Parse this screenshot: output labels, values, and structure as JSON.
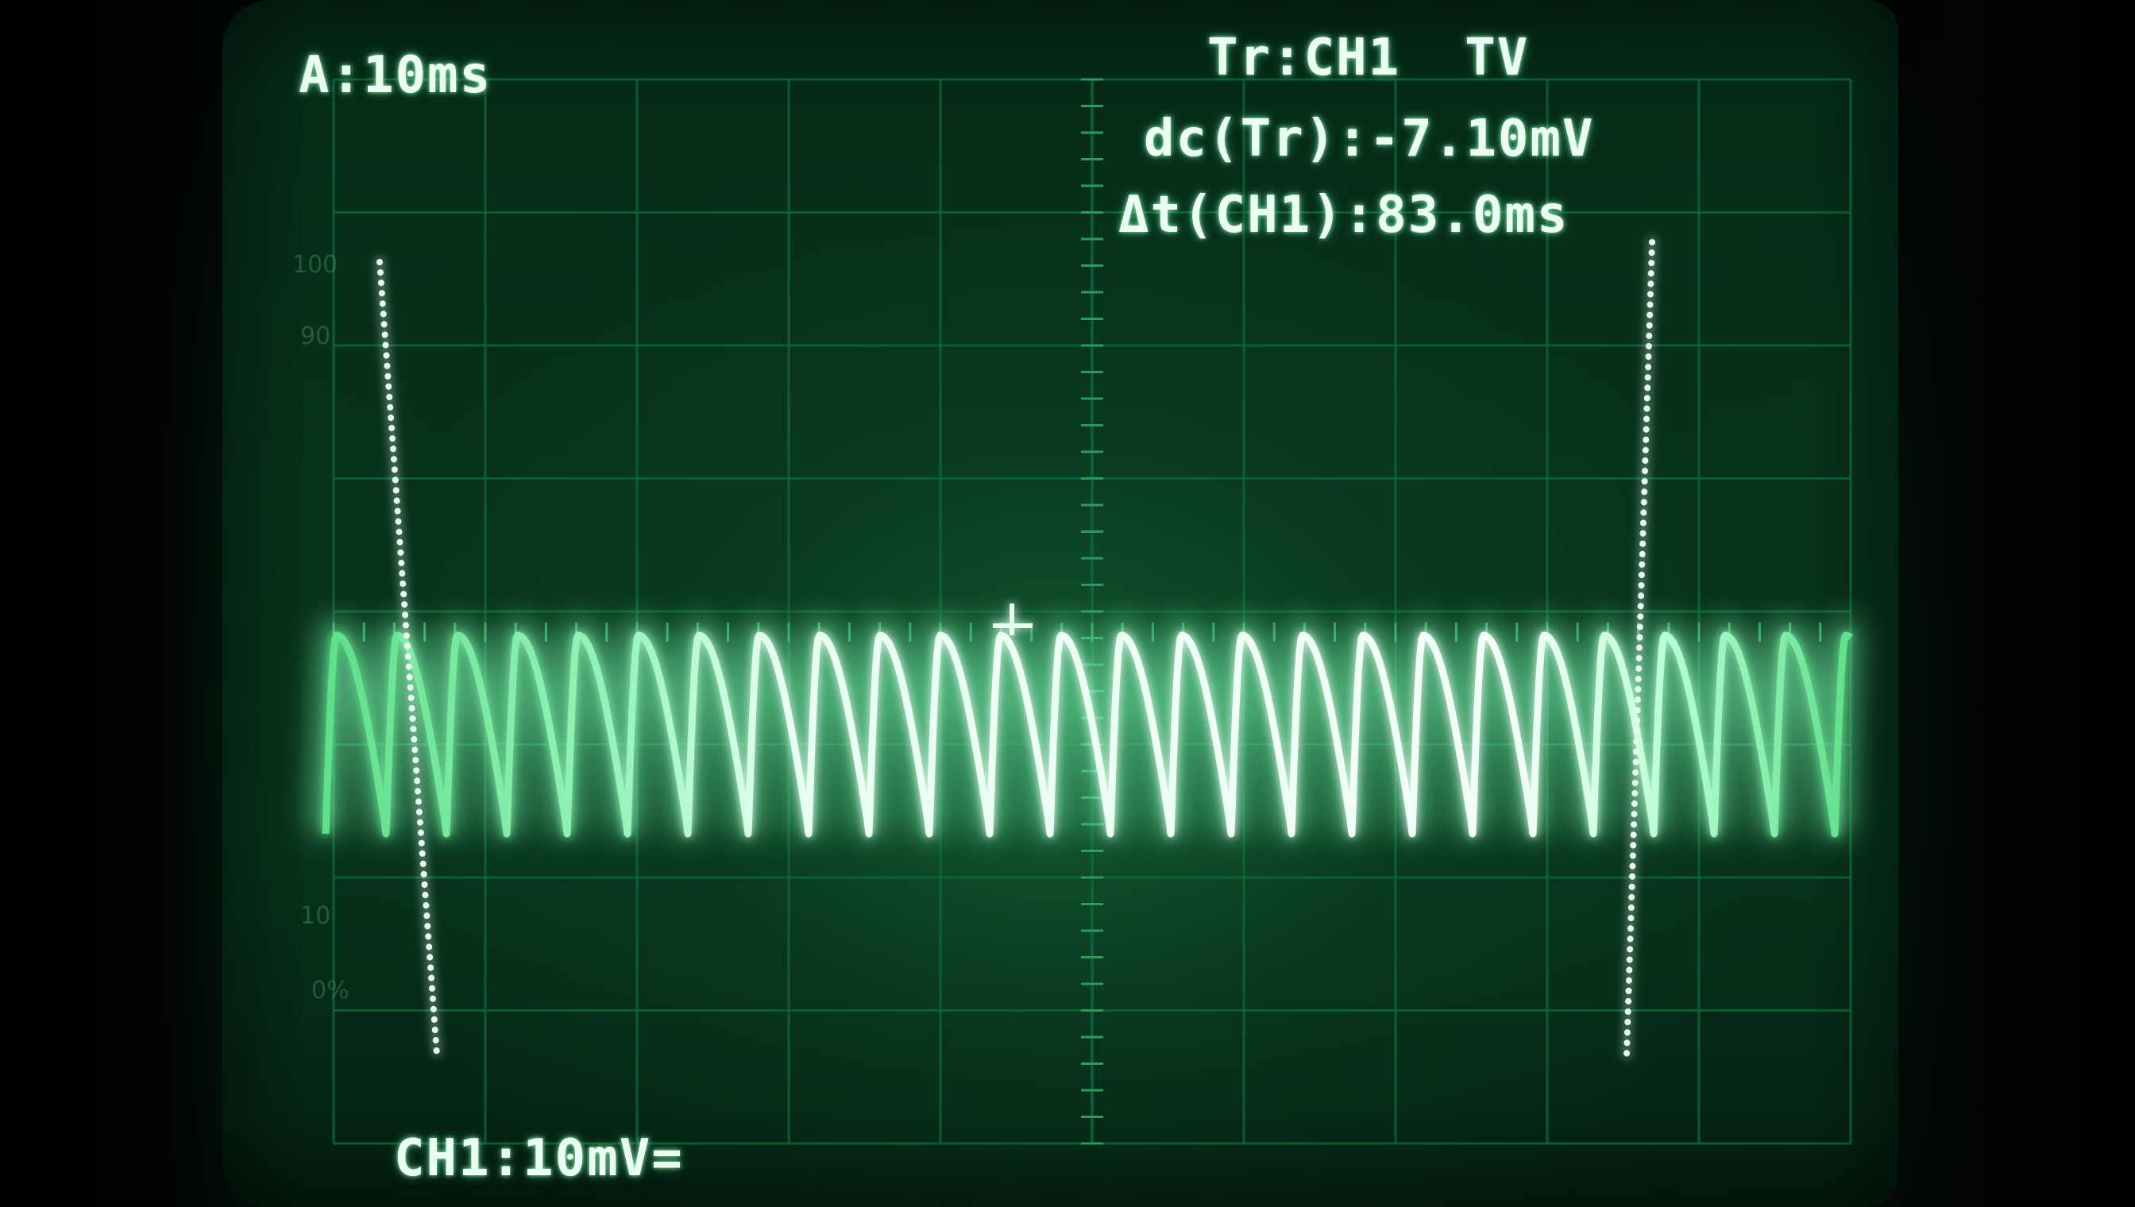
{
  "readout": {
    "timebase": "A:10ms",
    "trigger": "Tr:CH1  TV",
    "dc_level": "dc(Tr):-7.10mV",
    "delta_t": "Δt(CH1):83.0ms",
    "channel_scale": "CH1:10mV="
  },
  "graticule_labels": {
    "top": "100",
    "ninety": "90",
    "ten": "10",
    "zero": "0%"
  },
  "colors": {
    "trace": "#c8ffe0",
    "trace_dim": "#5fe08a",
    "grid": "#0f6b3a",
    "cursor": "#e6fff0",
    "text": "#eafff1"
  },
  "icons": {
    "cursor_marker": "dotted-vertical-line",
    "trigger_marker": "t-marker"
  }
}
